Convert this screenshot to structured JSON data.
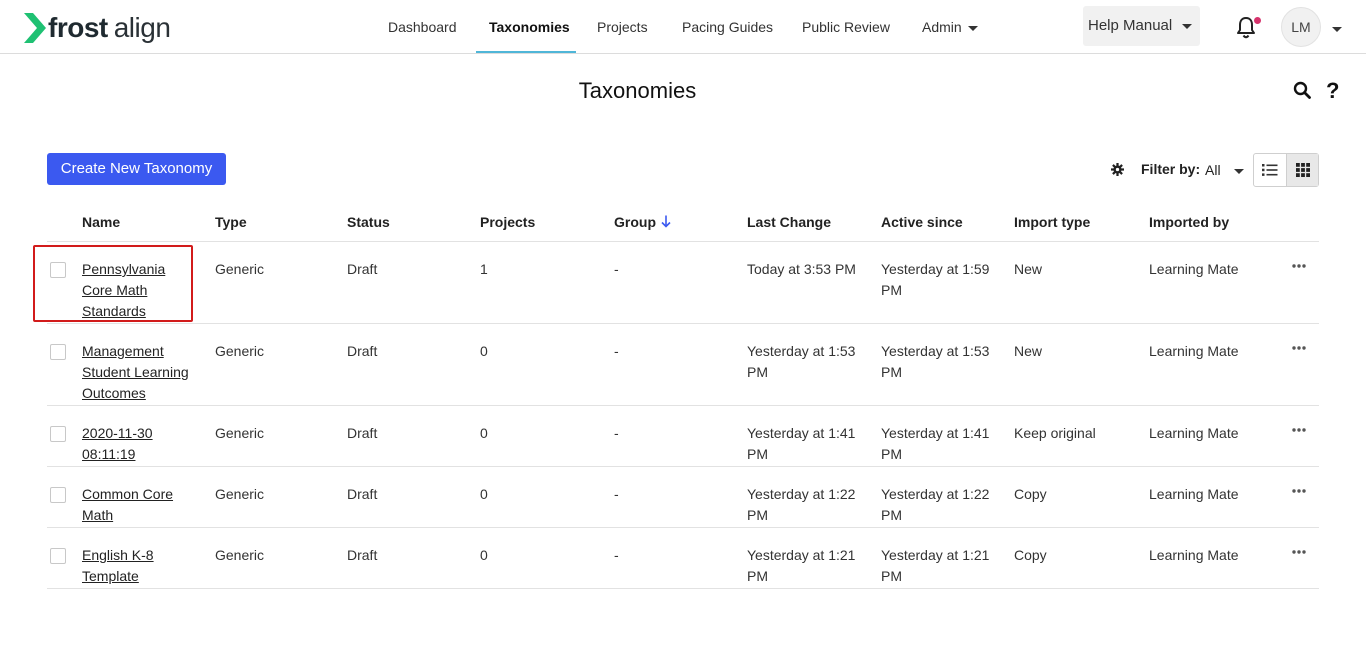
{
  "app": {
    "logo_bold": "frost",
    "logo_light": "align",
    "brand_color": "#1fc173"
  },
  "nav": {
    "items": [
      {
        "label": "Dashboard"
      },
      {
        "label": "Taxonomies"
      },
      {
        "label": "Projects"
      },
      {
        "label": "Pacing Guides"
      },
      {
        "label": "Public Review"
      },
      {
        "label": "Admin"
      }
    ],
    "active": "Taxonomies",
    "help_label": "Help Manual",
    "avatar_initials": "LM",
    "icons": {
      "bell": "bell-icon",
      "caret": "chevron-down-icon"
    }
  },
  "page": {
    "title": "Taxonomies",
    "create_label": "Create New Taxonomy",
    "filter_label": "Filter by:",
    "filter_value": "All",
    "accent_color": "#3b59f0",
    "icons": {
      "search": "search-icon",
      "help": "question-icon",
      "settings": "gear-icon",
      "list_view": "list-view-icon",
      "grid_view": "grid-view-icon"
    }
  },
  "table": {
    "headers": [
      "Name",
      "Type",
      "Status",
      "Projects",
      "Group",
      "Last Change",
      "Active since",
      "Import type",
      "Imported by"
    ],
    "sorted_by": "Group",
    "rows": [
      {
        "name": "Pennsylvania Core Math Standards",
        "type": "Generic",
        "status": "Draft",
        "projects": "1",
        "group": "-",
        "last_change": "Today at 3:53 PM",
        "active_since": "Yesterday at 1:59 PM",
        "import_type": "New",
        "imported_by": "Learning Mate"
      },
      {
        "name": "Management Student Learning Outcomes",
        "type": "Generic",
        "status": "Draft",
        "projects": "0",
        "group": "-",
        "last_change": "Yesterday at 1:53 PM",
        "active_since": "Yesterday at 1:53 PM",
        "import_type": "New",
        "imported_by": "Learning Mate"
      },
      {
        "name": "2020-11-30 08:11:19",
        "type": "Generic",
        "status": "Draft",
        "projects": "0",
        "group": "-",
        "last_change": "Yesterday at 1:41 PM",
        "active_since": "Yesterday at 1:41 PM",
        "import_type": "Keep original",
        "imported_by": "Learning Mate"
      },
      {
        "name": "Common Core Math",
        "type": "Generic",
        "status": "Draft",
        "projects": "0",
        "group": "-",
        "last_change": "Yesterday at 1:22 PM",
        "active_since": "Yesterday at 1:22 PM",
        "import_type": "Copy",
        "imported_by": "Learning Mate"
      },
      {
        "name": "English K-8 Template",
        "type": "Generic",
        "status": "Draft",
        "projects": "0",
        "group": "-",
        "last_change": "Yesterday at 1:21 PM",
        "active_since": "Yesterday at 1:21 PM",
        "import_type": "Copy",
        "imported_by": "Learning Mate"
      }
    ],
    "highlight_color": "#d21b1b"
  }
}
